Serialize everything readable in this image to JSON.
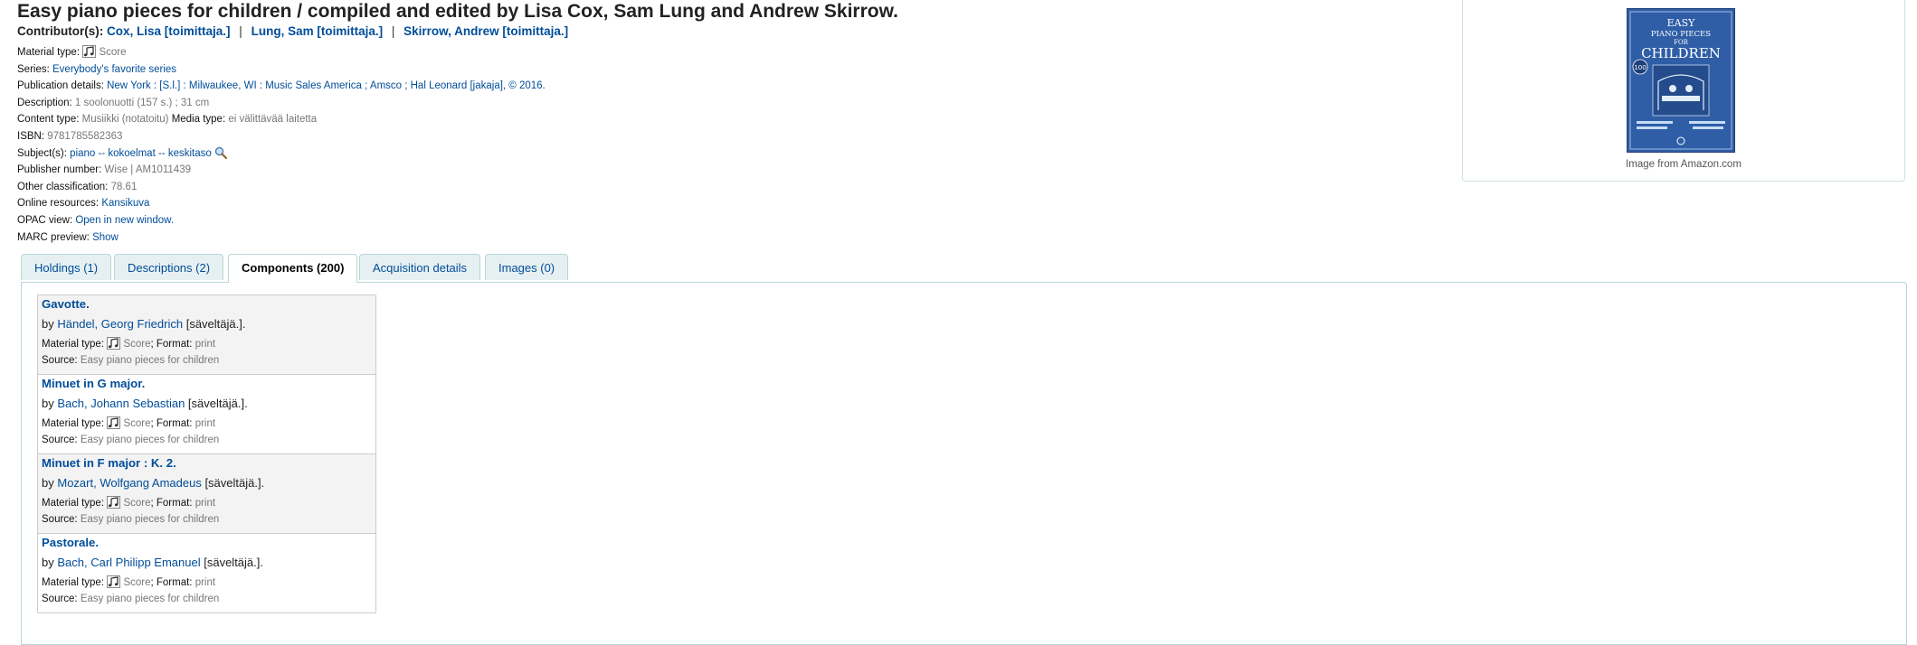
{
  "record": {
    "title": "Easy piano pieces for children / compiled and edited by Lisa Cox, Sam Lung and Andrew Skirrow.",
    "contributors_label": "Contributor(s):",
    "contributors": [
      "Cox, Lisa [toimittaja.]",
      "Lung, Sam [toimittaja.]",
      "Skirrow, Andrew [toimittaja.]"
    ],
    "separator": "|"
  },
  "fields": {
    "material_type": {
      "label": "Material type:",
      "value": "Score",
      "icon": "music-score-icon"
    },
    "series": {
      "label": "Series:",
      "value": "Everybody's favorite series"
    },
    "publication": {
      "label": "Publication details:",
      "value": "New York : [S.l.] : Milwaukee, WI : Music Sales America ; Amsco ; Hal Leonard [jakaja], © 2016."
    },
    "description": {
      "label": "Description:",
      "value": "1 soolonuotti (157 s.) ; 31 cm"
    },
    "content_type": {
      "label": "Content type:",
      "value": "Musiikki (notatoitu)",
      "media_label": "Media type:",
      "media_value": "ei välittävää laitetta"
    },
    "isbn": {
      "label": "ISBN:",
      "value": "9781785582363"
    },
    "subjects": {
      "label": "Subject(s):",
      "value": "piano -- kokoelmat -- keskitaso",
      "icon": "search-icon"
    },
    "publisher_number": {
      "label": "Publisher number:",
      "value": "Wise | AM1011439"
    },
    "other_classification": {
      "label": "Other classification:",
      "value": "78.61"
    },
    "online_resources": {
      "label": "Online resources:",
      "value": "Kansikuva"
    },
    "opac_view": {
      "label": "OPAC view:",
      "value": "Open in new window."
    },
    "marc_preview": {
      "label": "MARC preview:",
      "value": "Show"
    }
  },
  "cover": {
    "caption": "Image from Amazon.com",
    "art_line1": "EASY",
    "art_line2": "PIANO PIECES",
    "art_line3": "FOR",
    "art_line4": "CHILDREN",
    "art_badge": "100",
    "colors": {
      "background": "#2f5ea6",
      "text": "#ffffff"
    }
  },
  "tabs": [
    {
      "label": "Holdings (1)",
      "active": false
    },
    {
      "label": "Descriptions (2)",
      "active": false
    },
    {
      "label": "Components (200)",
      "active": true
    },
    {
      "label": "Acquisition details",
      "active": false
    },
    {
      "label": "Images (0)",
      "active": false
    }
  ],
  "components_labels": {
    "by": "by",
    "material_type": "Material type:",
    "format": "Format:",
    "source": "Source:"
  },
  "components": [
    {
      "title": "Gavotte.",
      "author": "Händel, Georg Friedrich",
      "role": "[säveltäjä.].",
      "material": "Score",
      "format": "print",
      "source": "Easy piano pieces for children"
    },
    {
      "title": "Minuet in G major.",
      "author": "Bach, Johann Sebastian",
      "role": "[säveltäjä.].",
      "material": "Score",
      "format": "print",
      "source": "Easy piano pieces for children"
    },
    {
      "title": "Minuet in F major : K. 2.",
      "author": "Mozart, Wolfgang Amadeus",
      "role": "[säveltäjä.].",
      "material": "Score",
      "format": "print",
      "source": "Easy piano pieces for children"
    },
    {
      "title": "Pastorale.",
      "author": "Bach, Carl Philipp Emanuel",
      "role": "[säveltäjä.].",
      "material": "Score",
      "format": "print",
      "source": "Easy piano pieces for children"
    }
  ]
}
